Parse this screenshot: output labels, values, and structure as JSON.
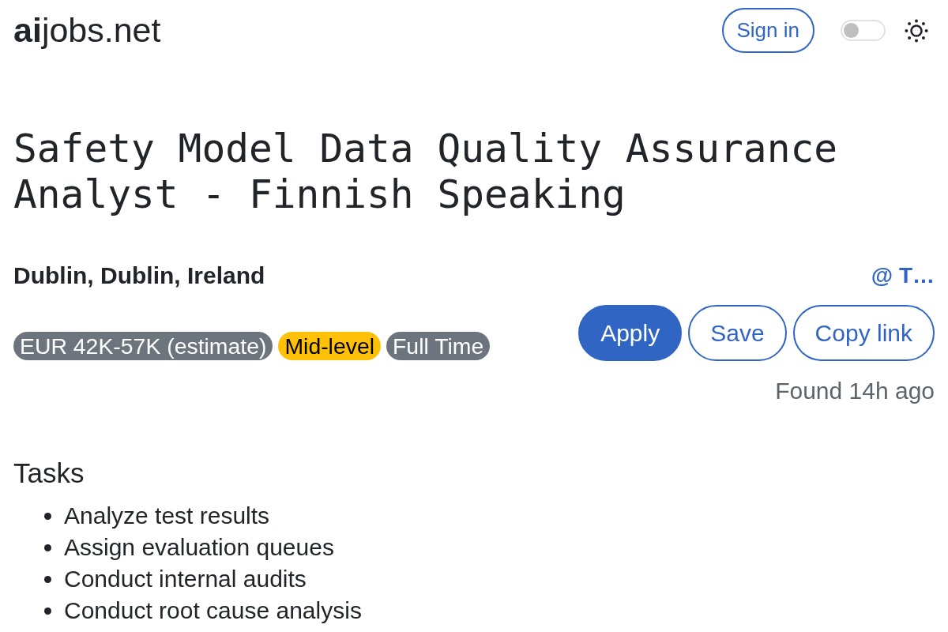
{
  "header": {
    "logo": "**ai**jobs.net",
    "sign_in": "Sign in",
    "theme_switch": {
      "on": false
    }
  },
  "job": {
    "title": "Safety Model Data Quality Assurance Analyst - Finnish Speaking",
    "location": "Dublin, Dublin, Ireland",
    "company": "@ T…",
    "tags": [
      {
        "label": "EUR 42K-57K (estimate)",
        "color": "#6c757d"
      },
      {
        "label": "Mid-level",
        "color": "#ffc107"
      },
      {
        "label": "Full Time",
        "color": "#6c757d"
      }
    ],
    "actions": [
      {
        "label": "Apply",
        "kind": "primary"
      },
      {
        "label": "Save",
        "kind": "outline"
      },
      {
        "label": "Copy link",
        "kind": "outline"
      }
    ],
    "posted": "Found 14h ago"
  },
  "tasks": {
    "heading": "Tasks",
    "items": [
      "Analyze test results",
      "Assign evaluation queues",
      "Conduct internal audits",
      "Conduct root cause analysis"
    ]
  }
}
